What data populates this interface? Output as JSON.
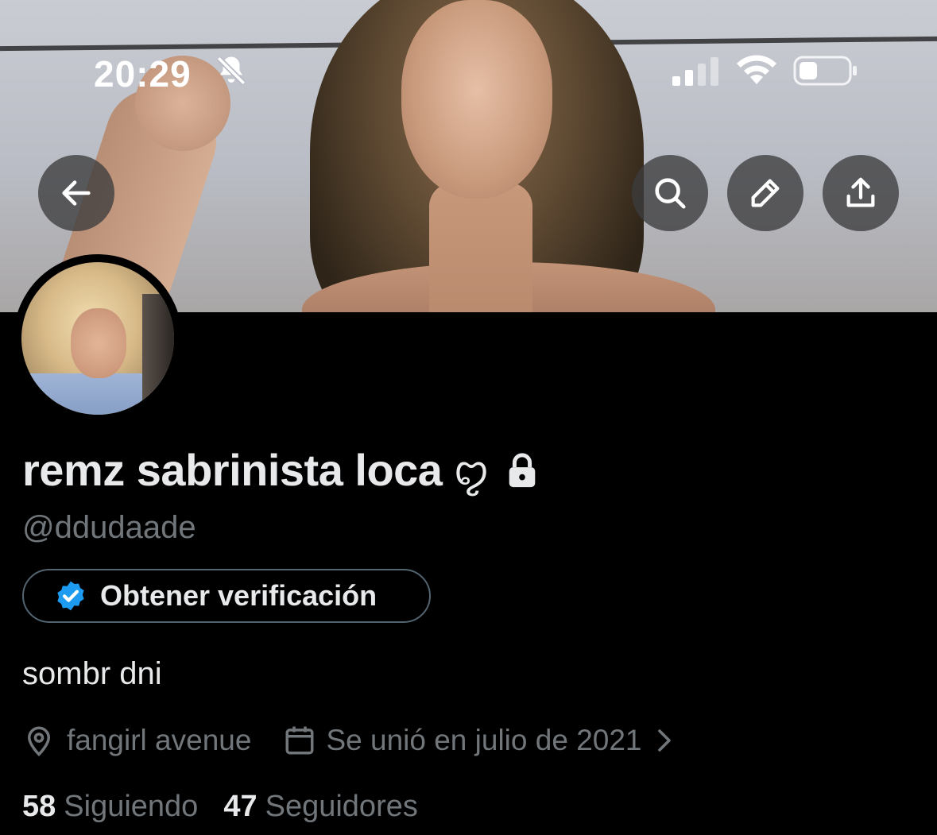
{
  "status_bar": {
    "time": "20:29",
    "icons": [
      "bell-slash-icon",
      "cellular-signal-icon",
      "wifi-icon",
      "battery-icon"
    ]
  },
  "header": {
    "banner": "header-photo",
    "buttons": [
      "back-arrow-icon",
      "search-icon",
      "pencil-icon",
      "share-icon"
    ]
  },
  "profile": {
    "avatar": "profile-photo",
    "display_name": "remz sabrinista loca",
    "name_decoration": "ꨄ",
    "protected_icon": "lock-icon",
    "handle": "@ddudaade",
    "verify_button_label": "Obtener verificación",
    "verify_badge_color": "#1d9bf0",
    "bio": "sombr dni",
    "location": "fangirl avenue",
    "joined": "Se unió en julio de 2021",
    "following_count": "58",
    "following_label": "Siguiendo",
    "followers_count": "47",
    "followers_label": "Seguidores"
  },
  "colors": {
    "background": "#000000",
    "primary_text": "#e7e9ea",
    "secondary_text": "#71767b",
    "accent": "#1d9bf0"
  }
}
